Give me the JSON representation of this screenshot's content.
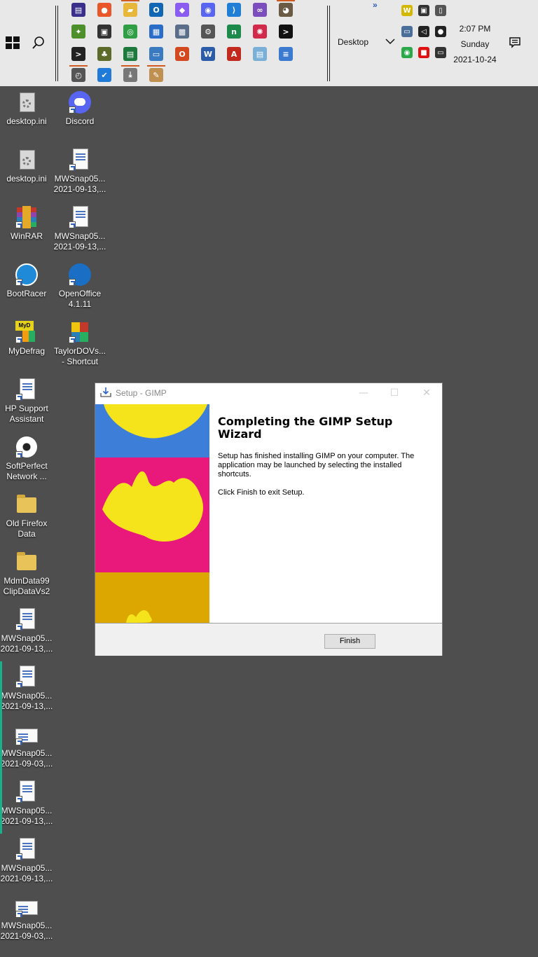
{
  "taskbar": {
    "toolbar_label": "Desktop",
    "more_label": "»",
    "clock": {
      "time": "2:07 PM",
      "day": "Sunday",
      "date": "2021-10-24"
    },
    "quicklaunch": [
      {
        "name": "winrar-icon",
        "color": "#3a2f8a",
        "glyph": "▤"
      },
      {
        "name": "firefox-icon",
        "color": "#e8562a",
        "glyph": "●"
      },
      {
        "name": "file-explorer-icon",
        "color": "#e7b73c",
        "glyph": "▰"
      },
      {
        "name": "outlook-icon",
        "color": "#1267b5",
        "glyph": "O"
      },
      {
        "name": "messenger-icon",
        "color": "#8a5cf0",
        "glyph": "◆"
      },
      {
        "name": "discord-icon",
        "color": "#5865f2",
        "glyph": "◉"
      },
      {
        "name": "vscode-icon",
        "color": "#1f7fd6",
        "glyph": "⟩"
      },
      {
        "name": "visual-studio-icon",
        "color": "#7c4dbd",
        "glyph": "∞"
      },
      {
        "name": "gimp-icon",
        "color": "#6b5b45",
        "glyph": "◕"
      },
      {
        "name": "windows-tool-icon",
        "color": "#4d8f2a",
        "glyph": "✦"
      },
      {
        "name": "camera-icon",
        "color": "#333333",
        "glyph": "▣"
      },
      {
        "name": "chrome-icon",
        "color": "#2f9e44",
        "glyph": "◎"
      },
      {
        "name": "control-panel-icon",
        "color": "#2a6dc9",
        "glyph": "▦"
      },
      {
        "name": "network-icon",
        "color": "#5a6e8a",
        "glyph": "▩"
      },
      {
        "name": "settings-gear-icon",
        "color": "#555555",
        "glyph": "⚙"
      },
      {
        "name": "green-app-icon",
        "color": "#1c8a4a",
        "glyph": "n"
      },
      {
        "name": "red-network-icon",
        "color": "#d12a4a",
        "glyph": "✺"
      },
      {
        "name": "command-prompt-icon",
        "color": "#111111",
        "glyph": ">"
      },
      {
        "name": "terminal-icon",
        "color": "#222222",
        "glyph": ">"
      },
      {
        "name": "tree-icon",
        "color": "#5c6b2a",
        "glyph": "♣"
      },
      {
        "name": "excel-utility-icon",
        "color": "#1d7a3c",
        "glyph": "▤"
      },
      {
        "name": "display-icon",
        "color": "#3a7ac0",
        "glyph": "▭"
      },
      {
        "name": "office-icon",
        "color": "#d4481f",
        "glyph": "O"
      },
      {
        "name": "word-icon",
        "color": "#2b5caa",
        "glyph": "W"
      },
      {
        "name": "acrobat-icon",
        "color": "#c22a1f",
        "glyph": "A"
      },
      {
        "name": "notepad-icon",
        "color": "#7ab0d8",
        "glyph": "▤"
      },
      {
        "name": "wordpad-icon",
        "color": "#3c7ad0",
        "glyph": "≡"
      },
      {
        "name": "clock-app-icon",
        "color": "#555555",
        "glyph": "◴"
      },
      {
        "name": "todo-icon",
        "color": "#1f7ad8",
        "glyph": "✔"
      },
      {
        "name": "download-icon",
        "color": "#777777",
        "glyph": "⤓"
      },
      {
        "name": "paint-icon",
        "color": "#c09050",
        "glyph": "✎"
      }
    ],
    "tray": [
      {
        "name": "wc-icon",
        "color": "#d4b800",
        "glyph": "W"
      },
      {
        "name": "tray-camera-icon",
        "color": "#333333",
        "glyph": "▣"
      },
      {
        "name": "usb-icon",
        "color": "#555555",
        "glyph": "▯"
      },
      {
        "name": "network-monitor-icon",
        "color": "#4a6e9a",
        "glyph": "▭"
      },
      {
        "name": "volume-icon",
        "color": "#222222",
        "glyph": "◁"
      },
      {
        "name": "microphone-icon",
        "color": "#222222",
        "glyph": "●"
      },
      {
        "name": "green-tray-icon",
        "color": "#2aa84a",
        "glyph": "◉"
      },
      {
        "name": "red-tray-icon",
        "color": "#e01010",
        "glyph": "■"
      },
      {
        "name": "display-tray-icon",
        "color": "#333333",
        "glyph": "▭"
      }
    ]
  },
  "desktop": {
    "icons": [
      {
        "name": "desktop-ini-1",
        "label": "desktop.ini",
        "type": "gear"
      },
      {
        "name": "discord-shortcut",
        "label": "Discord",
        "type": "discord"
      },
      {
        "name": "desktop-ini-2",
        "label": "desktop.ini",
        "type": "gear"
      },
      {
        "name": "mwsnap-1",
        "label": "MWSnap05...\n2021-09-13,...",
        "type": "doc"
      },
      {
        "name": "winrar-shortcut",
        "label": "WinRAR",
        "type": "winrar"
      },
      {
        "name": "mwsnap-2",
        "label": "MWSnap05...\n2021-09-13,...",
        "type": "doc"
      },
      {
        "name": "bootracer-shortcut",
        "label": "BootRacer",
        "type": "bootracer"
      },
      {
        "name": "openoffice-shortcut",
        "label": "OpenOffice\n4.1.11",
        "type": "openoffice"
      },
      {
        "name": "mydefrag-shortcut",
        "label": "MyDefrag",
        "type": "mydefrag"
      },
      {
        "name": "taylordov-shortcut",
        "label": "TaylorDOVs...\n- Shortcut",
        "type": "taylor"
      },
      {
        "name": "hp-support-shortcut",
        "label": "HP Support\nAssistant",
        "type": "blank"
      },
      {
        "name": "softperfect-shortcut",
        "label": "SoftPerfect\nNetwork ...",
        "type": "ball"
      },
      {
        "name": "old-firefox-folder",
        "label": "Old Firefox\nData",
        "type": "folder"
      },
      {
        "name": "mdmdata-folder",
        "label": "MdmData99\nClipDataVs2",
        "type": "folder"
      },
      {
        "name": "mwsnap-3",
        "label": "MWSnap05...\n2021-09-13,...",
        "type": "doc"
      },
      {
        "name": "mwsnap-4",
        "label": "MWSnap05...\n2021-09-13,...",
        "type": "doc"
      },
      {
        "name": "mwsnap-5",
        "label": "MWSnap05...\n2021-09-03,...",
        "type": "wide"
      },
      {
        "name": "mwsnap-6",
        "label": "MWSnap05...\n2021-09-13,...",
        "type": "doc"
      },
      {
        "name": "mwsnap-7",
        "label": "MWSnap05...\n2021-09-13,...",
        "type": "doc"
      },
      {
        "name": "mwsnap-8",
        "label": "MWSnap05...\n2021-09-03,...",
        "type": "wide"
      }
    ]
  },
  "dialog": {
    "title": "Setup - GIMP",
    "heading": "Completing the GIMP Setup Wizard",
    "paragraph1": "Setup has finished installing GIMP on your computer. The application may be launched by selecting the installed shortcuts.",
    "paragraph2": "Click Finish to exit Setup.",
    "finish_label": "Finish",
    "minimize_glyph": "—",
    "maximize_glyph": "☐",
    "close_glyph": "✕",
    "band_colors": [
      "#3d7fd8",
      "#e8197a",
      "#dca800"
    ],
    "wilber_color": "#f5e31c"
  }
}
